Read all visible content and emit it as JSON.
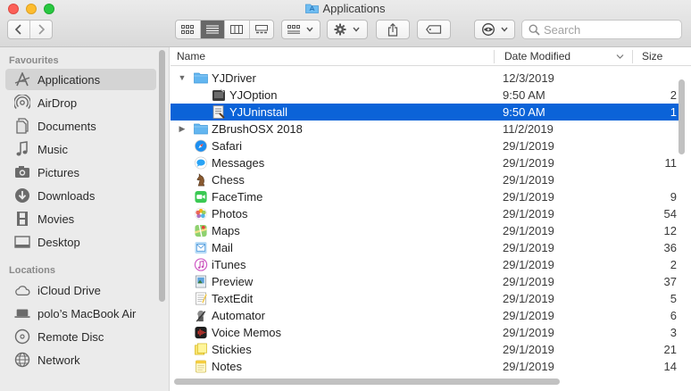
{
  "window": {
    "title": "Applications",
    "title_icon": "applications-folder-icon"
  },
  "toolbar": {
    "back_icon": "chevron-left-icon",
    "forward_icon": "chevron-right-icon",
    "view_modes": [
      "icon-view",
      "list-view",
      "column-view",
      "gallery-view"
    ],
    "active_view": "list-view",
    "group_icon": "group-by-icon",
    "action_icon": "gear-icon",
    "share_icon": "share-icon",
    "tag_icon": "tag-icon",
    "quicklook_icon": "eye-icon"
  },
  "search": {
    "placeholder": "Search"
  },
  "sidebar": {
    "favourites_header": "Favourites",
    "favourites": [
      {
        "label": "Applications",
        "icon": "applications-icon",
        "selected": true
      },
      {
        "label": "AirDrop",
        "icon": "airdrop-icon"
      },
      {
        "label": "Documents",
        "icon": "documents-icon"
      },
      {
        "label": "Music",
        "icon": "music-icon"
      },
      {
        "label": "Pictures",
        "icon": "pictures-icon"
      },
      {
        "label": "Downloads",
        "icon": "downloads-icon"
      },
      {
        "label": "Movies",
        "icon": "movies-icon"
      },
      {
        "label": "Desktop",
        "icon": "desktop-icon"
      }
    ],
    "locations_header": "Locations",
    "locations": [
      {
        "label": "iCloud Drive",
        "icon": "cloud-icon"
      },
      {
        "label": "polo’s MacBook Air",
        "icon": "laptop-icon"
      },
      {
        "label": "Remote Disc",
        "icon": "disc-icon"
      },
      {
        "label": "Network",
        "icon": "network-icon"
      }
    ]
  },
  "columns": {
    "name": "Name",
    "date_modified": "Date Modified",
    "size": "Size"
  },
  "rows": [
    {
      "name": "YJDriver",
      "date": "12/3/2019",
      "size": "",
      "icon": "folder-icon",
      "disclosure": "▼",
      "indent": 0
    },
    {
      "name": "YJOption",
      "date": "9:50 AM",
      "size": "2",
      "icon": "app-icon",
      "disclosure": "",
      "indent": 1
    },
    {
      "name": "YJUninstall",
      "date": "9:50 AM",
      "size": "1",
      "icon": "script-icon",
      "disclosure": "",
      "indent": 1,
      "selected": true
    },
    {
      "name": "ZBrushOSX 2018",
      "date": "11/2/2019",
      "size": "",
      "icon": "folder-icon",
      "disclosure": "▶",
      "indent": 0
    },
    {
      "name": "Safari",
      "date": "29/1/2019",
      "size": "",
      "icon": "safari-icon",
      "disclosure": "",
      "indent": 0
    },
    {
      "name": "Messages",
      "date": "29/1/2019",
      "size": "11",
      "icon": "messages-icon",
      "disclosure": "",
      "indent": 0
    },
    {
      "name": "Chess",
      "date": "29/1/2019",
      "size": "",
      "icon": "chess-icon",
      "disclosure": "",
      "indent": 0
    },
    {
      "name": "FaceTime",
      "date": "29/1/2019",
      "size": "9",
      "icon": "facetime-icon",
      "disclosure": "",
      "indent": 0
    },
    {
      "name": "Photos",
      "date": "29/1/2019",
      "size": "54",
      "icon": "photos-icon",
      "disclosure": "",
      "indent": 0
    },
    {
      "name": "Maps",
      "date": "29/1/2019",
      "size": "12",
      "icon": "maps-icon",
      "disclosure": "",
      "indent": 0
    },
    {
      "name": "Mail",
      "date": "29/1/2019",
      "size": "36",
      "icon": "mail-icon",
      "disclosure": "",
      "indent": 0
    },
    {
      "name": "iTunes",
      "date": "29/1/2019",
      "size": "2",
      "icon": "itunes-icon",
      "disclosure": "",
      "indent": 0
    },
    {
      "name": "Preview",
      "date": "29/1/2019",
      "size": "37",
      "icon": "preview-icon",
      "disclosure": "",
      "indent": 0
    },
    {
      "name": "TextEdit",
      "date": "29/1/2019",
      "size": "5",
      "icon": "textedit-icon",
      "disclosure": "",
      "indent": 0
    },
    {
      "name": "Automator",
      "date": "29/1/2019",
      "size": "6",
      "icon": "automator-icon",
      "disclosure": "",
      "indent": 0
    },
    {
      "name": "Voice Memos",
      "date": "29/1/2019",
      "size": "3",
      "icon": "voice-memos-icon",
      "disclosure": "",
      "indent": 0
    },
    {
      "name": "Stickies",
      "date": "29/1/2019",
      "size": "21",
      "icon": "stickies-icon",
      "disclosure": "",
      "indent": 0
    },
    {
      "name": "Notes",
      "date": "29/1/2019",
      "size": "14",
      "icon": "notes-icon",
      "disclosure": "",
      "indent": 0
    }
  ],
  "colors": {
    "selection": "#0b63d8",
    "sidebar_bg": "#ebebeb",
    "sidebar_selected": "#d4d4d4",
    "folder": "#5ab4f0"
  }
}
